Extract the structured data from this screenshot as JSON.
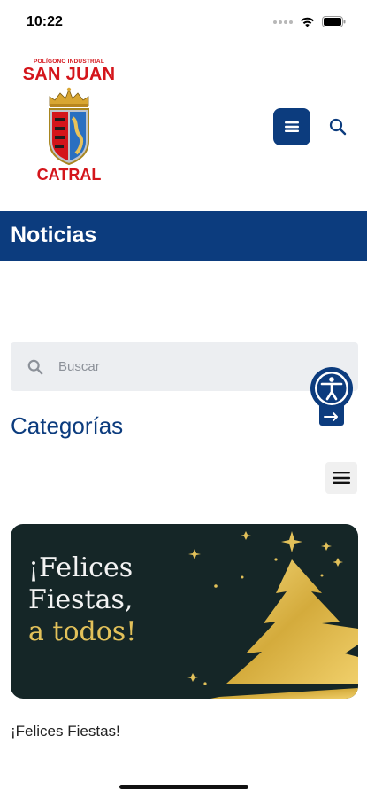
{
  "status_bar": {
    "time": "10:22"
  },
  "header": {
    "logo": {
      "top_text": "POLÍGONO INDUSTRIAL",
      "name": "SAN JUAN",
      "bottom_text": "CATRAL"
    },
    "menu_icon": "hamburger-icon",
    "search_icon": "search-icon"
  },
  "page": {
    "title": "Noticias"
  },
  "search": {
    "placeholder": "Buscar"
  },
  "categories": {
    "title": "Categorías"
  },
  "news": [
    {
      "image_lines": [
        "¡Felices",
        "Fiestas,",
        "a todos!"
      ],
      "title": "¡Felices Fiestas!"
    }
  ],
  "colors": {
    "primary": "#0c3c7e",
    "logo_red": "#d4151b",
    "card_bg": "#152627",
    "gold": "#e2c15a"
  }
}
